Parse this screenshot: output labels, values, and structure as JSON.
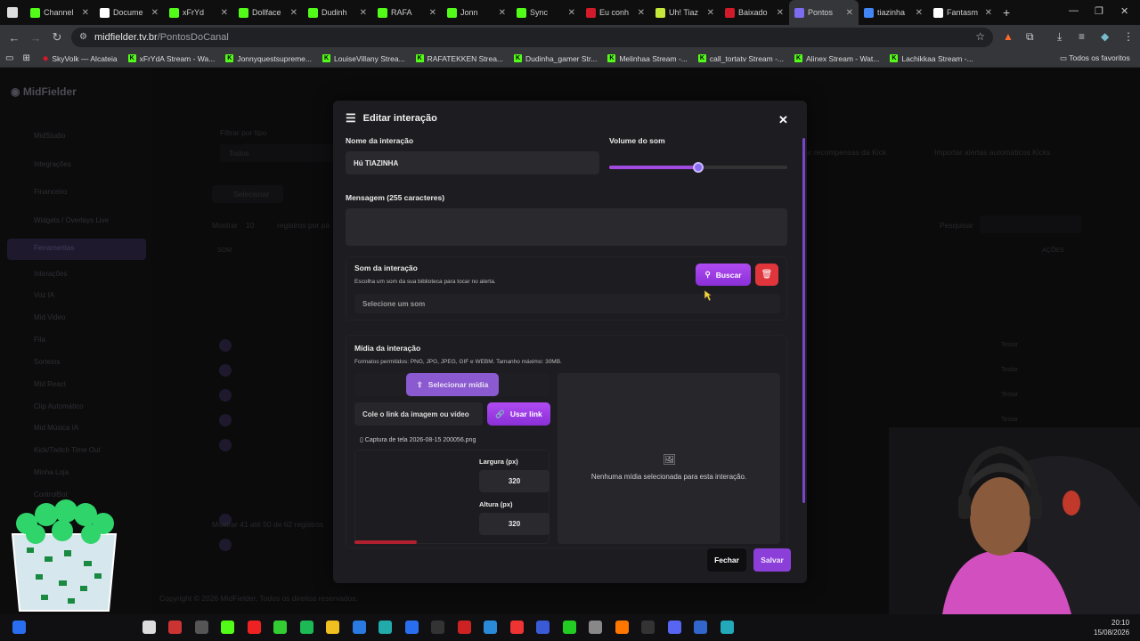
{
  "browser": {
    "tabs": [
      {
        "label": "Channel",
        "color": "#53fc18"
      },
      {
        "label": "Docume",
        "color": "#ffffff"
      },
      {
        "label": "xFrYd",
        "color": "#53fc18"
      },
      {
        "label": "Dollface",
        "color": "#53fc18"
      },
      {
        "label": "Dudinh",
        "color": "#53fc18"
      },
      {
        "label": "RAFA",
        "color": "#53fc18"
      },
      {
        "label": "Jonn",
        "color": "#53fc18"
      },
      {
        "label": "Sync",
        "color": "#53fc18"
      },
      {
        "label": "Eu conh",
        "color": "#d11a2a"
      },
      {
        "label": "Uh! Tiaz",
        "color": "#c6e83a"
      },
      {
        "label": "Baixado",
        "color": "#d11a2a"
      },
      {
        "label": "Pontos",
        "color": "#7b6cf0"
      },
      {
        "label": "tiazinha",
        "color": "#4285f4"
      },
      {
        "label": "Fantasm",
        "color": "#ffffff"
      }
    ],
    "url_host": "midfielder.tv.br",
    "url_path": "/PontosDoCanal",
    "bookmarks": [
      "SkyVolk — Alcateia",
      "xFrYdA Stream - Wa...",
      "Jonnyquestsupreme...",
      "LouiseVillany Strea...",
      "RAFATEKKEN Strea...",
      "Dudinha_gamer Str...",
      "Melinhaa Stream -...",
      "call_tortatv Stream -...",
      "Alinex Stream - Wat...",
      "Lachikkaa Stream -..."
    ],
    "favorites_label": "Todos os favoritos"
  },
  "sidebar": {
    "brand": "MidFielder",
    "items": [
      "MidStudio",
      "Integrações",
      "Financeiro",
      "Widgets / Overlays Live",
      "Ferramentas",
      "Interações",
      "Voz IA",
      "Mid Video",
      "Fila",
      "Sorteios",
      "Mid React",
      "Clip Automático",
      "Mid Música IA",
      "Kick/Twitch Time Out",
      "Minha Loja",
      "ControlBot"
    ]
  },
  "background": {
    "filter_label": "Filtrar por tipo",
    "filter_value": "Todos",
    "select_label": "Selecionar",
    "show_label": "Mostrar",
    "show_value": "10",
    "records_label": "registros por pá",
    "search_label": "Pesquisar",
    "footer_records": "Mostrar 41 até 50 de 62 registros",
    "copyright": "Copyright © 2026 MidFielder. Todos os direitos reservados.",
    "top_btn1": "ar recompensas da Kick",
    "top_btn2": "Importar alertas automáticos Kicks",
    "col_sound": "SOM",
    "col_actions": "AÇÕES",
    "test_label": "Testar"
  },
  "modal": {
    "title": "Editar interação",
    "name_label": "Nome da interação",
    "name_value": "Hú TIAZINHA",
    "volume_label": "Volume do som",
    "volume_value": 0.5,
    "message_label": "Mensagem (255 caracteres)",
    "message_value": "",
    "sound_title": "Som da interação",
    "sound_hint": "Escolha um som da sua biblioteca para tocar no alerta.",
    "search_button": "Buscar",
    "sound_placeholder": "Selecione um som",
    "media_title": "Mídia da interação",
    "media_hint": "Formatos permitidos: PNG, JPG, JPEG, GIF e WEBM. Tamanho máximo: 30MB.",
    "select_media_button": "Selecionar mídia",
    "link_placeholder": "Cole o link da imagem ou vídeo",
    "use_link_button": "Usar link",
    "file_name": "Captura de tela 2026-08-15 200056.png",
    "width_label": "Largura (px)",
    "width_value": "320",
    "height_label": "Altura (px)",
    "height_value": "320",
    "no_media_text": "Nenhuma mídia selecionada para esta interação.",
    "close_button": "Fechar",
    "save_button": "Salvar"
  },
  "taskbar": {
    "time": "20:10",
    "date": "15/08/2026"
  }
}
